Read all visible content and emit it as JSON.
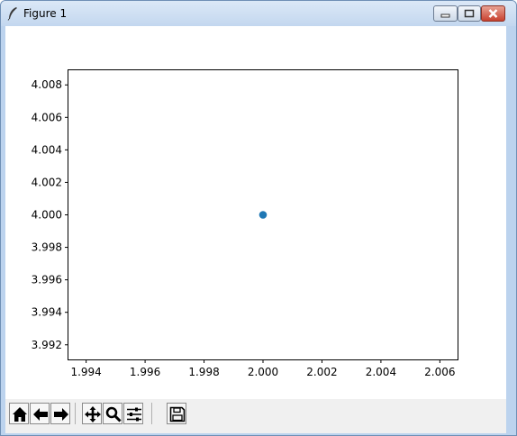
{
  "window": {
    "title": "Figure 1",
    "icon": "feather-icon",
    "controls": [
      "minimize-icon",
      "maximize-icon",
      "close-icon"
    ]
  },
  "toolbar": {
    "tools": [
      {
        "name": "home",
        "icon": "home-icon"
      },
      {
        "name": "back",
        "icon": "back-arrow-icon"
      },
      {
        "name": "forward",
        "icon": "forward-arrow-icon"
      },
      {
        "name": "pan",
        "icon": "pan-icon"
      },
      {
        "name": "zoom",
        "icon": "magnifier-icon"
      },
      {
        "name": "configure-subplots",
        "icon": "sliders-icon"
      },
      {
        "name": "save",
        "icon": "floppy-disk-icon"
      }
    ]
  },
  "chart_data": {
    "type": "scatter",
    "title": "",
    "xlabel": "",
    "ylabel": "",
    "x": [
      2.0
    ],
    "y": [
      4.0
    ],
    "xlim": [
      1.9934,
      2.0066
    ],
    "ylim": [
      3.9911,
      4.0089
    ],
    "xticks": [
      {
        "value": 1.994,
        "label": "1.994"
      },
      {
        "value": 1.996,
        "label": "1.996"
      },
      {
        "value": 1.998,
        "label": "1.998"
      },
      {
        "value": 2.0,
        "label": "2.000"
      },
      {
        "value": 2.002,
        "label": "2.002"
      },
      {
        "value": 2.004,
        "label": "2.004"
      },
      {
        "value": 2.006,
        "label": "2.006"
      }
    ],
    "yticks": [
      {
        "value": 3.992,
        "label": "3.992"
      },
      {
        "value": 3.994,
        "label": "3.994"
      },
      {
        "value": 3.996,
        "label": "3.996"
      },
      {
        "value": 3.998,
        "label": "3.998"
      },
      {
        "value": 4.0,
        "label": "4.000"
      },
      {
        "value": 4.002,
        "label": "4.002"
      },
      {
        "value": 4.004,
        "label": "4.004"
      },
      {
        "value": 4.006,
        "label": "4.006"
      },
      {
        "value": 4.008,
        "label": "4.008"
      }
    ],
    "marker_color": "#1f77b4",
    "grid": false,
    "legend": "none"
  }
}
